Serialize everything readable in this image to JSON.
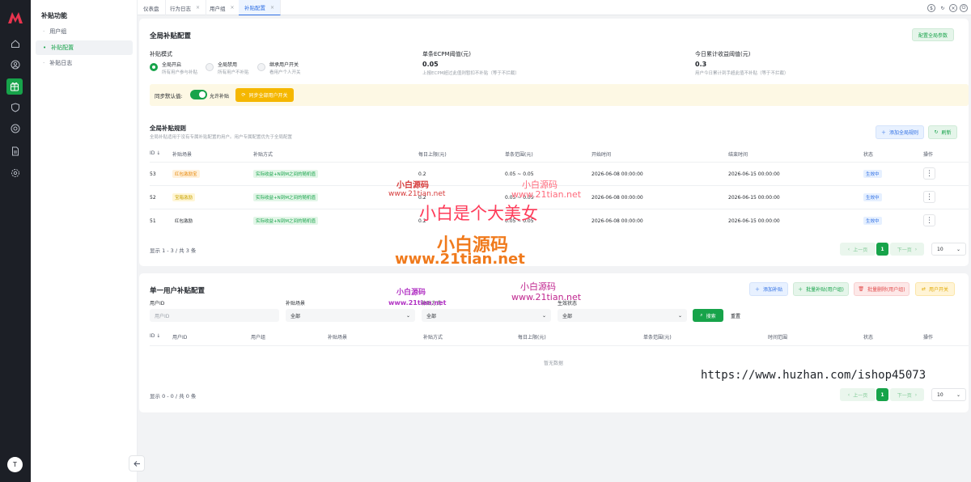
{
  "rail": {
    "items": [
      "home-icon",
      "user-icon",
      "gift-icon",
      "shield-icon",
      "settings-circle-icon",
      "document-icon",
      "gear-icon"
    ],
    "avatar_letter": "T"
  },
  "sidebar": {
    "title": "补贴功能",
    "items": [
      {
        "label": "用户组"
      },
      {
        "label": "补贴配置"
      },
      {
        "label": "补贴日志"
      }
    ]
  },
  "tabs": [
    {
      "label": "仪表盘"
    },
    {
      "label": "行为日志"
    },
    {
      "label": "用户组"
    },
    {
      "label": "补贴配置"
    }
  ],
  "global": {
    "title": "全局补贴配置",
    "config_button": "配置全局参数",
    "mode_label": "补贴模式",
    "modes": [
      {
        "label": "全局开启",
        "desc": "所有用户参与补贴"
      },
      {
        "label": "全局禁用",
        "desc": "所有用户不补贴"
      },
      {
        "label": "继承用户开关",
        "desc": "看用户个人开关"
      }
    ],
    "ecpm_label": "单条ECPM阈值(元)",
    "ecpm_value": "0.05",
    "ecpm_desc": "上报ECPM超过此值则暂扣不补贴（等于不拦截）",
    "daily_label": "今日累计收益阈值(元)",
    "daily_value": "0.3",
    "daily_desc": "用户今日累计到手超此值不补贴（等于不拦截）",
    "sync_label": "同步默认值:",
    "sync_toggle_text": "允许补贴",
    "sync_button": "同步全部用户开关"
  },
  "rules": {
    "title": "全局补贴规则",
    "desc": "全局补贴适用于没有专属补贴配置的用户。用户专属配置优先于全局配置",
    "add_button": "添加全局规则",
    "refresh_button": "刷新",
    "columns": [
      "ID ↓",
      "补贴场景",
      "补贴方式",
      "每日上限(元)",
      "单条范围(元)",
      "开始时间",
      "结束时间",
      "状态",
      "操作"
    ],
    "rows": [
      {
        "id": "53",
        "scene": "红包激励宝",
        "scene_style": "orange",
        "method": "实际收益+N到M之间的随机值",
        "daily": "0.2",
        "range": "0.05 ~ 0.05",
        "start": "2026-06-08 00:00:00",
        "end": "2026-06-15 00:00:00",
        "status": "生效中"
      },
      {
        "id": "52",
        "scene": "宝箱激励",
        "scene_style": "yellow",
        "method": "实际收益+N到M之间的随机值",
        "daily": "0.2",
        "range": "0.05 ~ 0.05",
        "start": "2026-06-08 00:00:00",
        "end": "2026-06-15 00:00:00",
        "status": "生效中"
      },
      {
        "id": "51",
        "scene": "红包激励",
        "scene_style": "plain",
        "method": "实际收益+N到M之间的随机值",
        "daily": "0.2",
        "range": "0.05 ~ 0.05",
        "start": "2026-06-08 00:00:00",
        "end": "2026-06-15 00:00:00",
        "status": "生效中"
      }
    ],
    "total": "显示 1 - 3 / 共 3 条",
    "prev": "上一页",
    "next": "下一页",
    "page": "1",
    "size": "10"
  },
  "user_cfg": {
    "title": "单一用户补贴配置",
    "add_button": "添加补贴",
    "batch_add_button": "批量补贴(用户组)",
    "batch_delete_button": "批量删除(用户组)",
    "user_switch_button": "用户开关",
    "filter_user_id_label": "用户ID",
    "filter_user_id_placeholder": "用户ID",
    "filter_scene_label": "补贴场景",
    "filter_scene_value": "全部",
    "filter_method_label": "补贴方式",
    "filter_method_value": "全部",
    "filter_status_label": "生效状态",
    "filter_status_value": "全部",
    "search_button": "搜索",
    "reset_button": "重置",
    "columns": [
      "ID ↓",
      "用户ID",
      "用户组",
      "补贴场景",
      "补贴方式",
      "每日上限(元)",
      "单条范围(元)",
      "时间范围",
      "状态",
      "操作"
    ],
    "empty": "暂无数据",
    "total": "显示 0 - 0 / 共 0 条",
    "prev": "上一页",
    "next": "下一页",
    "page": "1",
    "size": "10"
  },
  "watermarks": {
    "a": "小白源码",
    "b": "www.21tian.net",
    "c": "小白源码",
    "d": "www.21tian.net",
    "e": "小白是个大美女",
    "f": "小白源码",
    "g": "www.21tian.net",
    "h": "小白源码",
    "i": "www.21tian.net",
    "j": "小白源码",
    "k": "www.21tian.net",
    "l": "https://www.huzhan.com/ishop45073"
  },
  "colors": {
    "accent": "#17a34a",
    "rail": "#1c1f26",
    "warning": "#f5b700",
    "info": "#2f6fe4"
  }
}
